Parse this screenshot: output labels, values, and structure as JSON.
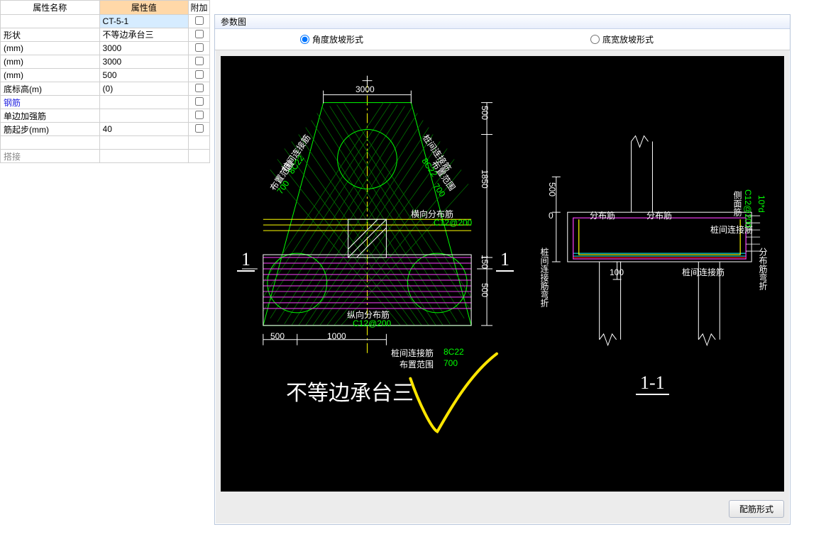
{
  "prop": {
    "header_name": "属性名称",
    "header_value": "属性值",
    "header_extra": "附加",
    "code_value": "CT-5-1",
    "rows": [
      {
        "name": "形状",
        "value": "不等边承台三"
      },
      {
        "name": "(mm)",
        "value": "3000"
      },
      {
        "name": "(mm)",
        "value": "3000"
      },
      {
        "name": "(mm)",
        "value": "500"
      },
      {
        "name": "底标高(m)",
        "value": "(0)"
      },
      {
        "name": "钢筋",
        "value": "",
        "blue": true
      },
      {
        "name": "单边加强筋",
        "value": ""
      },
      {
        "name": "筋起步(mm)",
        "value": "40"
      },
      {
        "name": "",
        "value": ""
      },
      {
        "name": "搭接",
        "value": "",
        "grey": true
      }
    ]
  },
  "dlg": {
    "title": "参数图",
    "radio1": "角度放坡形式",
    "radio2": "底宽放坡形式",
    "button": "配筋形式"
  },
  "diagram": {
    "top_dim": "3000",
    "right_dims": [
      "500",
      "1850",
      "150",
      "500"
    ],
    "bottom_1": {
      "a": "500",
      "b": "1000"
    },
    "plan_labels": {
      "left_name": "桩间连接筋",
      "left_spec": "8C22",
      "left_range": "布置范围",
      "left_range_v": "700",
      "right_name": "桩间连接筋",
      "right_spec": "8C22",
      "right_range": "布置范围",
      "right_range_v": "700",
      "horiz": "横向分布筋",
      "horiz_spec": "C12@200",
      "vert": "纵向分布筋",
      "vert_spec": "C12@200",
      "bottom_name": "桩间连接筋",
      "bottom_spec": "8C22",
      "bottom_range": "布置范围",
      "bottom_range_v": "700",
      "section_mark": "1"
    },
    "title_left": "不等边承台三",
    "section_right": {
      "title": "1-1",
      "left_dim": [
        "500",
        "0"
      ],
      "dist1": "分布筋",
      "dist2": "分布筋",
      "side": "侧面筋",
      "side_spec": "C12@200",
      "lap": "10*d",
      "pile_conn_top": "桩间连接筋",
      "pile_conn_bottom": "桩间连接筋",
      "left_label": "桩间连接筋弯折",
      "right_label": "分布筋弯折",
      "inner_dim": "100"
    }
  }
}
